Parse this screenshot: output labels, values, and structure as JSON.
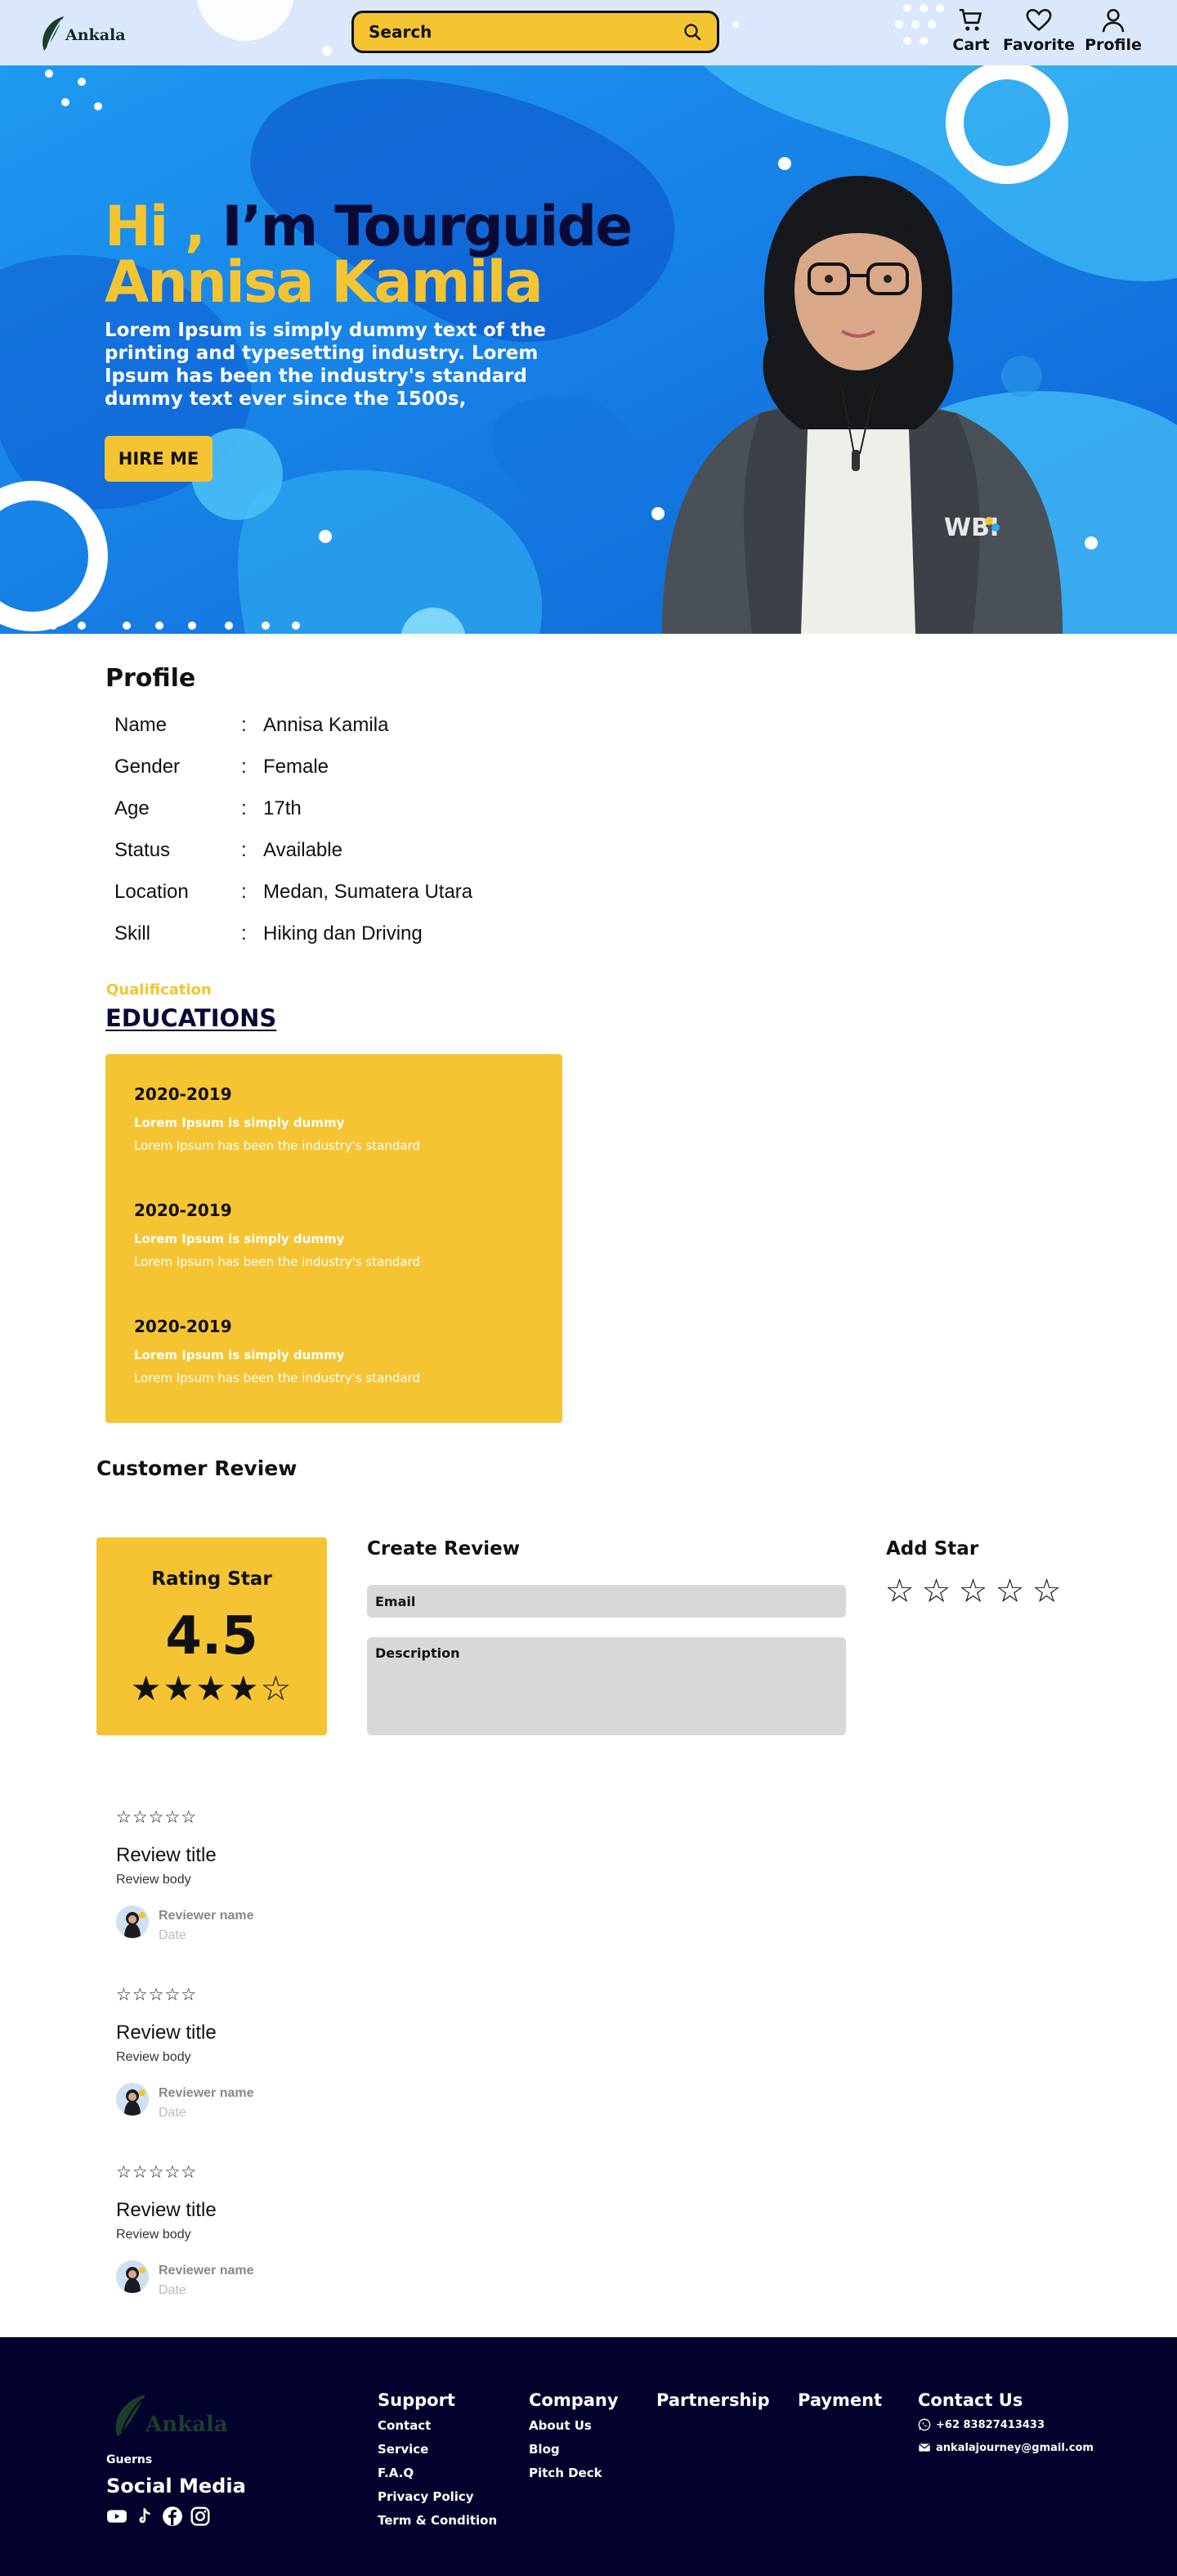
{
  "header": {
    "logo_text": "Ankala",
    "search_placeholder": "Search",
    "nav": [
      {
        "label": "Cart",
        "icon": "cart-icon"
      },
      {
        "label": "Favorite",
        "icon": "heart-icon"
      },
      {
        "label": "Profile",
        "icon": "user-icon"
      }
    ]
  },
  "hero": {
    "greeting": "Hi ,",
    "intro": "I’m Tourguide",
    "name": "Annisa Kamila",
    "description": "Lorem Ipsum is simply dummy text of the printing and typesetting industry. Lorem Ipsum has been the industry's standard dummy text ever since the 1500s,",
    "cta": "HIRE ME",
    "portrait_badge": "WBI",
    "colors": {
      "accent": "#f4c432",
      "dark": "#0a0a36",
      "hero_blue": "#1b8ae8"
    }
  },
  "profile": {
    "title": "Profile",
    "rows": [
      {
        "label": "Name",
        "value": "Annisa Kamila"
      },
      {
        "label": "Gender",
        "value": "Female"
      },
      {
        "label": "Age",
        "value": "17th"
      },
      {
        "label": "Status",
        "value": "Available"
      },
      {
        "label": "Location",
        "value": "Medan, Sumatera Utara"
      },
      {
        "label": "Skill",
        "value": "Hiking dan Driving"
      }
    ]
  },
  "qualification": {
    "label": "Qualification",
    "title": "EDUCATIONS",
    "items": [
      {
        "year": "2020-2019",
        "subtitle": "Lorem Ipsum is simply dummy",
        "body": "Lorem Ipsum has been the industry's standard"
      },
      {
        "year": "2020-2019",
        "subtitle": "Lorem Ipsum is simply dummy",
        "body": "Lorem Ipsum has been the industry's standard"
      },
      {
        "year": "2020-2019",
        "subtitle": "Lorem Ipsum is simply dummy",
        "body": "Lorem Ipsum has been the industry's standard"
      }
    ]
  },
  "review": {
    "section_title": "Customer Review",
    "rating_title": "Rating Star",
    "rating_value": "4.5",
    "rating_stars": "★★★★☆",
    "create_title": "Create Review",
    "email_placeholder": "Email",
    "description_placeholder": "Description",
    "add_star_title": "Add Star",
    "add_stars": [
      "☆",
      "☆",
      "☆",
      "☆",
      "☆"
    ],
    "items": [
      {
        "stars": "☆☆☆☆☆",
        "title": "Review title",
        "body": "Review body",
        "name": "Reviewer name",
        "date": "Date"
      },
      {
        "stars": "☆☆☆☆☆",
        "title": "Review title",
        "body": "Review body",
        "name": "Reviewer name",
        "date": "Date"
      },
      {
        "stars": "☆☆☆☆☆",
        "title": "Review title",
        "body": "Review body",
        "name": "Reviewer name",
        "date": "Date"
      }
    ]
  },
  "footer": {
    "logo_text": "Ankala",
    "brand": "Guerns",
    "social_title": "Social Media",
    "social_icons": [
      "youtube-icon",
      "tiktok-icon",
      "facebook-icon",
      "instagram-icon"
    ],
    "support": {
      "title": "Support",
      "links": [
        "Contact",
        "Service",
        "F.A.Q",
        "Privacy Policy",
        "Term & Condition"
      ]
    },
    "company": {
      "title": "Company",
      "links": [
        "About Us",
        "Blog",
        "Pitch Deck"
      ]
    },
    "partnership": {
      "title": "Partnership"
    },
    "payment": {
      "title": "Payment"
    },
    "contact": {
      "title": "Contact Us",
      "phone": "+62 83827413433",
      "email": "ankalajourney@gmail.com"
    }
  }
}
